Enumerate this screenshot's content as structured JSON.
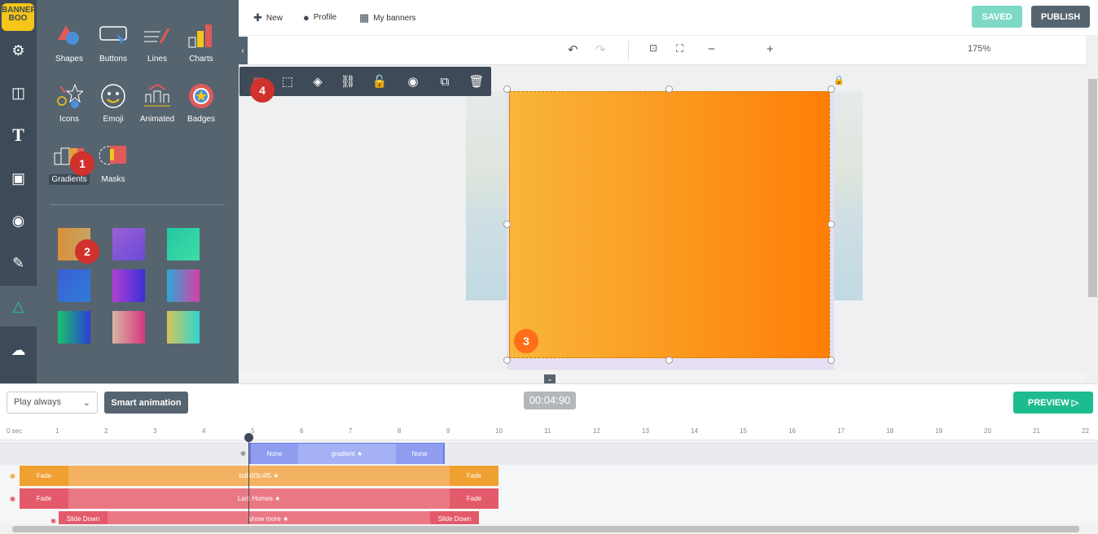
{
  "logo": {
    "text": "BANNER BOO"
  },
  "rail": {
    "items": [
      {
        "name": "settings",
        "glyph": "⚙"
      },
      {
        "name": "layout",
        "glyph": "◫"
      },
      {
        "name": "text",
        "glyph": "T"
      },
      {
        "name": "image",
        "glyph": "▣"
      },
      {
        "name": "video",
        "glyph": "◉"
      },
      {
        "name": "brush",
        "glyph": "✎"
      },
      {
        "name": "elements",
        "glyph": "△"
      },
      {
        "name": "upload",
        "glyph": "☁"
      }
    ]
  },
  "panel": {
    "tools": [
      "Shapes",
      "Buttons",
      "Lines",
      "Charts",
      "Icons",
      "Emoji",
      "Animated",
      "Badges",
      "Gradients",
      "Masks"
    ],
    "swatches": [
      "linear-gradient(90deg,#d98f3a,#c7a463)",
      "linear-gradient(135deg,#9b5fd6,#6a4bd6)",
      "linear-gradient(135deg,#22c7a2,#3fdca5)",
      "linear-gradient(135deg,#3a5fd6,#2f7cd6)",
      "linear-gradient(90deg,#b13fd6,#3a2fd6)",
      "linear-gradient(90deg,#2fa6d6,#d63fa6)",
      "linear-gradient(90deg,#19c26b,#2a3fd6)",
      "linear-gradient(90deg,#d9b6a0,#d6367f)",
      "linear-gradient(90deg,#d6c35a,#2fd6d0)"
    ]
  },
  "badges": [
    "1",
    "2",
    "3",
    "4"
  ],
  "topbar": {
    "new": "New",
    "profile": "Profile",
    "my_banners": "My banners",
    "saved": "SAVED",
    "publish": "PUBLISH"
  },
  "zoom": {
    "value": "175%",
    "minus": "−",
    "plus": "+"
  },
  "timeline": {
    "play_mode": "Play always",
    "smart": "Smart animation",
    "time": "00:04:90",
    "preview": "PREVIEW",
    "ruler": [
      "0 sec",
      "1",
      "2",
      "3",
      "4",
      "5",
      "6",
      "7",
      "8",
      "9",
      "10",
      "11",
      "12",
      "13",
      "14",
      "15",
      "16",
      "17",
      "18",
      "19",
      "20",
      "21",
      "22"
    ],
    "tracks": [
      {
        "in": "None",
        "name": "gradient",
        "out": "None"
      },
      {
        "in": "Fade",
        "name": "bd66f3c4f5",
        "out": "Fade"
      },
      {
        "in": "Fade",
        "name": "Lark Homes",
        "out": "Fade"
      },
      {
        "in": "Slide Down",
        "name": "show more",
        "out": "Slide Down"
      }
    ]
  },
  "colors": {
    "accent": "#1dbc8e",
    "rail": "#3e4a57",
    "panel": "#56646f",
    "badge": "#d0312d",
    "badge3": "#ff6f1a"
  }
}
